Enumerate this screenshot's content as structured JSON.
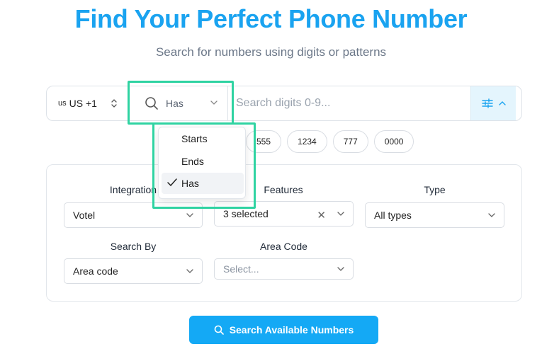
{
  "header": {
    "title": "Find Your Perfect Phone Number",
    "subtitle": "Search for numbers using digits or patterns"
  },
  "search": {
    "country_flag": "us",
    "country_label": "US +1",
    "mode_value": "Has",
    "digits_placeholder": "Search digits 0-9..."
  },
  "mode_options": [
    {
      "label": "Starts",
      "selected": false
    },
    {
      "label": "Ends",
      "selected": false
    },
    {
      "label": "Has",
      "selected": true
    }
  ],
  "suggestions": [
    "555",
    "1234",
    "777",
    "0000"
  ],
  "filters": {
    "integration": {
      "label": "Integration",
      "value": "Votel"
    },
    "features": {
      "label": "Features",
      "value": "3 selected"
    },
    "type": {
      "label": "Type",
      "value": "All types"
    },
    "search_by": {
      "label": "Search By",
      "value": "Area code"
    },
    "area_code": {
      "label": "Area Code",
      "placeholder": "Select..."
    }
  },
  "submit_label": "Search Available Numbers",
  "colors": {
    "accent": "#1aa3f0",
    "button": "#14a9f5",
    "highlight": "#2fd3a2"
  }
}
